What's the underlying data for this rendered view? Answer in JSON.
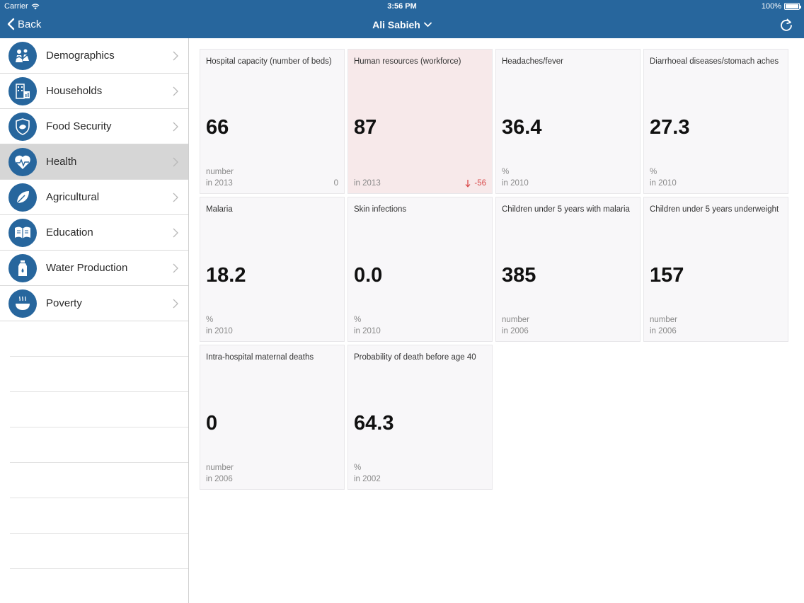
{
  "status_bar": {
    "carrier": "Carrier",
    "time": "3:56 PM",
    "battery": "100%"
  },
  "nav": {
    "back_label": "Back",
    "title": "Ali Sabieh"
  },
  "colors": {
    "brand": "#27669d",
    "alert_bg": "#f7e9ea",
    "alert_text": "#d94a4a"
  },
  "sidebar": {
    "items": [
      {
        "label": "Demographics",
        "icon": "demographics-icon"
      },
      {
        "label": "Households",
        "icon": "households-icon"
      },
      {
        "label": "Food Security",
        "icon": "food-security-icon"
      },
      {
        "label": "Health",
        "icon": "health-icon",
        "selected": true
      },
      {
        "label": "Agricultural",
        "icon": "agricultural-icon"
      },
      {
        "label": "Education",
        "icon": "education-icon"
      },
      {
        "label": "Water Production",
        "icon": "water-production-icon"
      },
      {
        "label": "Poverty",
        "icon": "poverty-icon"
      }
    ]
  },
  "cards": [
    {
      "title": "Hospital capacity (number of beds)",
      "value": "66",
      "unit": "number",
      "year": "in 2013",
      "change": "0"
    },
    {
      "title": "Human resources (workforce)",
      "value": "87",
      "unit": "",
      "year": "in 2013",
      "change": "-56",
      "direction": "down"
    },
    {
      "title": "Headaches/fever",
      "value": "36.4",
      "unit": "%",
      "year": "in 2010"
    },
    {
      "title": "Diarrhoeal diseases/stomach aches",
      "value": "27.3",
      "unit": "%",
      "year": "in 2010"
    },
    {
      "title": "Malaria",
      "value": "18.2",
      "unit": "%",
      "year": "in 2010"
    },
    {
      "title": "Skin infections",
      "value": "0.0",
      "unit": "%",
      "year": "in 2010"
    },
    {
      "title": "Children under 5 years with malaria",
      "value": "385",
      "unit": "number",
      "year": "in 2006"
    },
    {
      "title": "Children under 5 years underweight",
      "value": "157",
      "unit": "number",
      "year": "in 2006"
    },
    {
      "title": "Intra-hospital maternal deaths",
      "value": "0",
      "unit": "number",
      "year": "in 2006"
    },
    {
      "title": "Probability of death before age 40",
      "value": "64.3",
      "unit": "%",
      "year": "in 2002"
    }
  ]
}
